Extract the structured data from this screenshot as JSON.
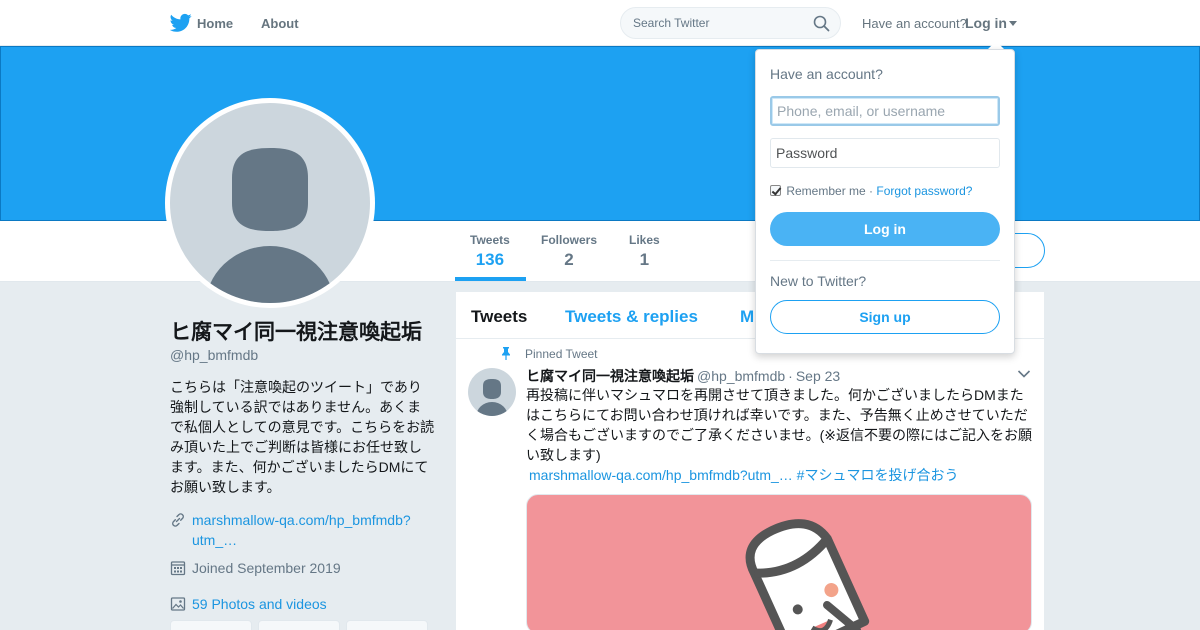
{
  "nav": {
    "home": "Home",
    "about": "About",
    "search_placeholder": "Search Twitter",
    "have_account": "Have an account?",
    "login": "Log in"
  },
  "profile": {
    "name": "ヒ腐マイ同一視注意喚起垢",
    "handle": "@hp_bmfmdb",
    "bio": "こちらは「注意喚起のツイート」であり強制している訳ではありません。あくまで私個人としての意見です。こちらをお読み頂いた上でご判断は皆様にお任せ致します。また、何かございましたらDMにてお願い致します。",
    "link": "marshmallow-qa.com/hp_bmfmdb?utm_…",
    "joined": "Joined September 2019",
    "photos": "59 Photos and videos"
  },
  "stats": [
    {
      "label": "Tweets",
      "value": "136"
    },
    {
      "label": "Followers",
      "value": "2"
    },
    {
      "label": "Likes",
      "value": "1"
    }
  ],
  "timeline_tabs": [
    "Tweets",
    "Tweets & replies",
    "M"
  ],
  "tweet": {
    "pinned_label": "Pinned Tweet",
    "name": "ヒ腐マイ同一視注意喚起垢",
    "handle": "@hp_bmfmdb",
    "separator": "·",
    "date": "Sep 23",
    "text": "再投稿に伴いマシュマロを再開させて頂きました。何かございましたらDMまたはこちらにてお問い合わせ頂ければ幸いです。また、予告無く止めさせていただく場合もございますのでご了承くださいませ。(※返信不要の際にはご記入をお願い致します)",
    "link": "marshmallow-qa.com/hp_bmfmdb?utm_…",
    "hashtag": "#マシュマロを投げ合おう"
  },
  "login_dropdown": {
    "title": "Have an account?",
    "username_placeholder": "Phone, email, or username",
    "password_placeholder": "Password",
    "remember": "Remember me",
    "dot": "·",
    "forgot": "Forgot password?",
    "login_button": "Log in",
    "new_to": "New to Twitter?",
    "signup_button": "Sign up"
  },
  "colors": {
    "brand": "#1da1f2",
    "banner": "#1da1f2",
    "media_bg": "#f29499",
    "background": "#e6ecf0"
  }
}
